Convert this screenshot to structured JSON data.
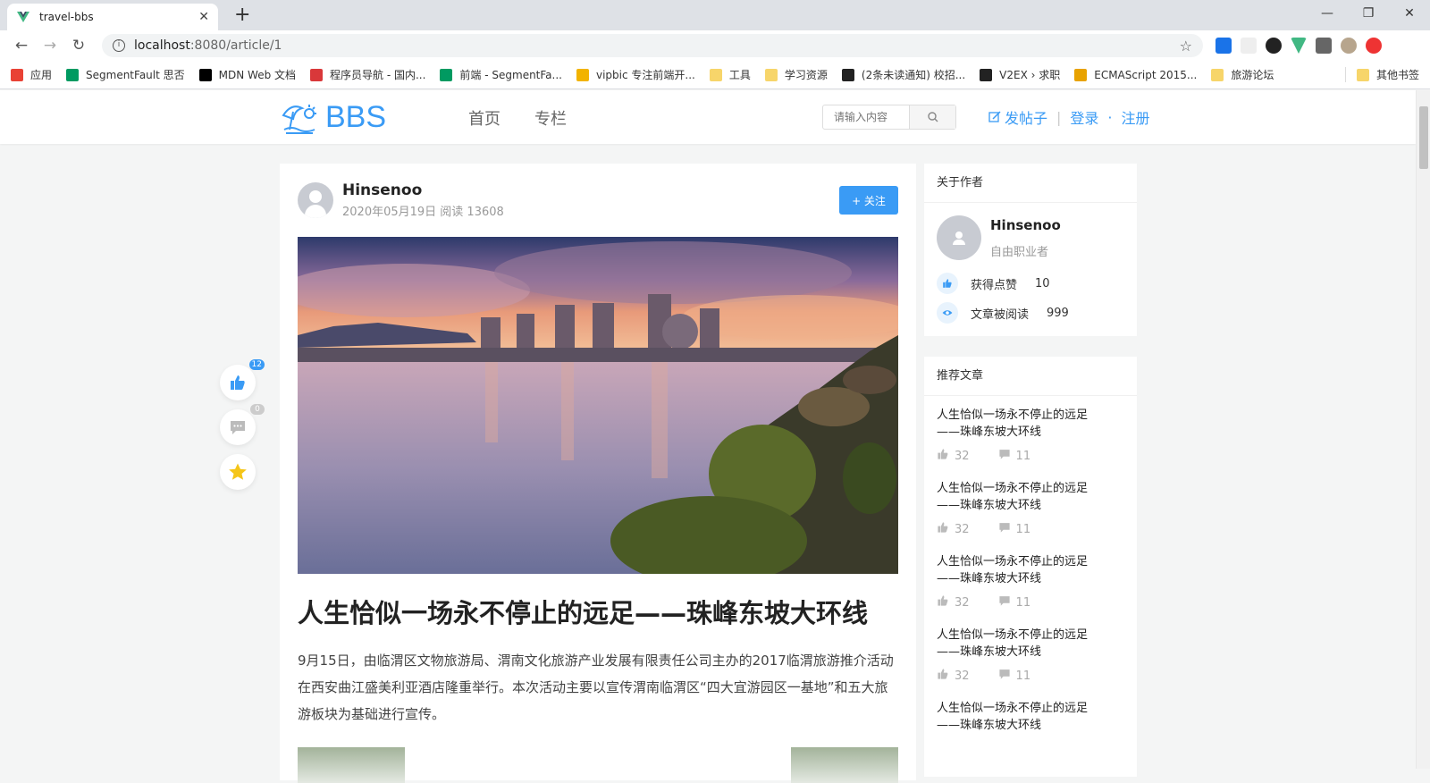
{
  "browser": {
    "tab_title": "travel-bbs",
    "url_host": "localhost",
    "url_rest": ":8080/article/1",
    "window_controls": [
      "—",
      "❐",
      "✕"
    ],
    "bookmarks": [
      {
        "label": "应用",
        "color": "#e94235"
      },
      {
        "label": "SegmentFault 思否",
        "color": "#009a61"
      },
      {
        "label": "MDN Web 文档",
        "color": "#000000"
      },
      {
        "label": "程序员导航 - 国内...",
        "color": "#d9383a"
      },
      {
        "label": "前端 - SegmentFa...",
        "color": "#009a61"
      },
      {
        "label": "vipbic 专注前端开...",
        "color": "#f2b300"
      },
      {
        "label": "工具",
        "color": "#f7d56a"
      },
      {
        "label": "学习资源",
        "color": "#f7d56a"
      },
      {
        "label": "(2条未读通知) 校招...",
        "color": "#222222"
      },
      {
        "label": "V2EX › 求职",
        "color": "#222222"
      },
      {
        "label": "ECMAScript 2015...",
        "color": "#e8a200"
      },
      {
        "label": "旅游论坛",
        "color": "#f7d56a"
      }
    ],
    "other_bookmarks": "其他书签"
  },
  "header": {
    "logo_text": "BBS",
    "nav": [
      "首页",
      "专栏"
    ],
    "search_placeholder": "请输入内容",
    "post_label": "发帖子",
    "login_label": "登录",
    "dot": "·",
    "register_label": "注册",
    "separator": "|"
  },
  "article": {
    "author_name": "Hinsenoo",
    "date_reads": "2020年05月19日 阅读 13608",
    "follow_label": "+ 关注",
    "title": "人生恰似一场永不停止的远足——珠峰东坡大环线",
    "body": "9月15日，由临渭区文物旅游局、渭南文化旅游产业发展有限责任公司主办的2017临渭旅游推介活动在西安曲江盛美利亚酒店隆重举行。本次活动主要以宣传渭南临渭区“四大宜游园区一基地”和五大旅游板块为基础进行宣传。"
  },
  "floating": {
    "like_count": "12",
    "comment_count": "0"
  },
  "about": {
    "header": "关于作者",
    "name": "Hinsenoo",
    "job": "自由职业者",
    "likes_label": "获得点赞",
    "likes_value": "10",
    "reads_label": "文章被阅读",
    "reads_value": "999"
  },
  "recommend": {
    "header": "推荐文章",
    "items": [
      {
        "title": "人生恰似一场永不停止的远足——珠峰东坡大环线",
        "likes": "32",
        "comments": "11"
      },
      {
        "title": "人生恰似一场永不停止的远足——珠峰东坡大环线",
        "likes": "32",
        "comments": "11"
      },
      {
        "title": "人生恰似一场永不停止的远足——珠峰东坡大环线",
        "likes": "32",
        "comments": "11"
      },
      {
        "title": "人生恰似一场永不停止的远足——珠峰东坡大环线",
        "likes": "32",
        "comments": "11"
      },
      {
        "title": "人生恰似一场永不停止的远足——珠峰东坡大环线",
        "likes": "",
        "comments": ""
      }
    ]
  },
  "colors": {
    "brand": "#3a9bf5",
    "star": "#f5c518"
  }
}
